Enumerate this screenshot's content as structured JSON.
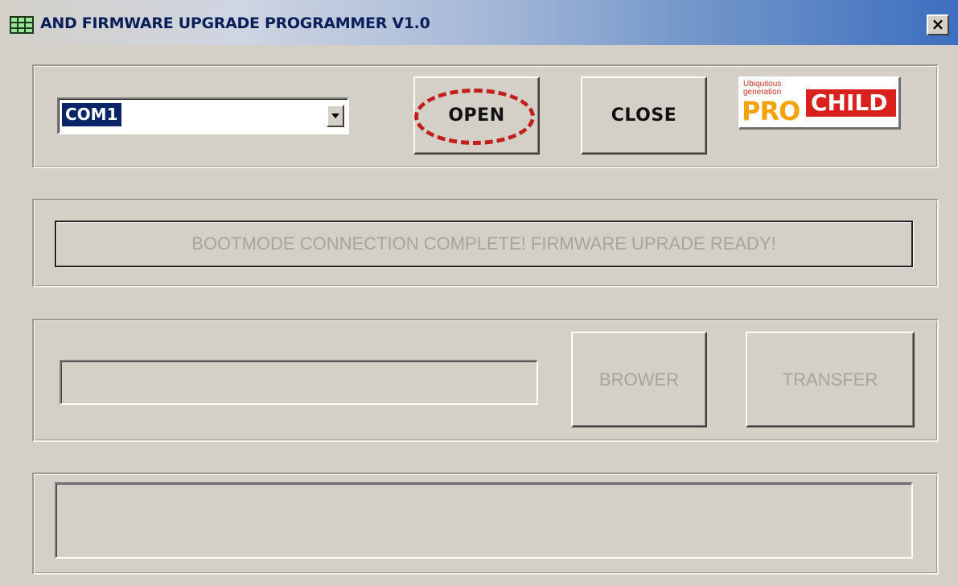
{
  "window": {
    "title": "AND FIRMWARE UPGRADE PROGRAMMER V1.0",
    "close_label": "×"
  },
  "connection": {
    "port_selected": "COM1",
    "open_label": "OPEN",
    "close_label": "CLOSE"
  },
  "logo": {
    "tagline_line1": "Ubiquitous",
    "tagline_line2": "generation",
    "brand_part1": "PRO",
    "brand_part2": "CHILD"
  },
  "status": {
    "message": "BOOTMODE CONNECTION COMPLETE! FIRMWARE UPRADE READY!"
  },
  "upgrade": {
    "file_path": "",
    "brower_label": "BROWER",
    "transfer_label": "TRANSFER"
  },
  "log": {
    "text": ""
  },
  "colors": {
    "window_face": "#d4d0c8",
    "title_text": "#0a1e5a",
    "selection": "#0a246a",
    "highlight_annotation": "#c0201c",
    "disabled_text": "#a8a49c"
  }
}
